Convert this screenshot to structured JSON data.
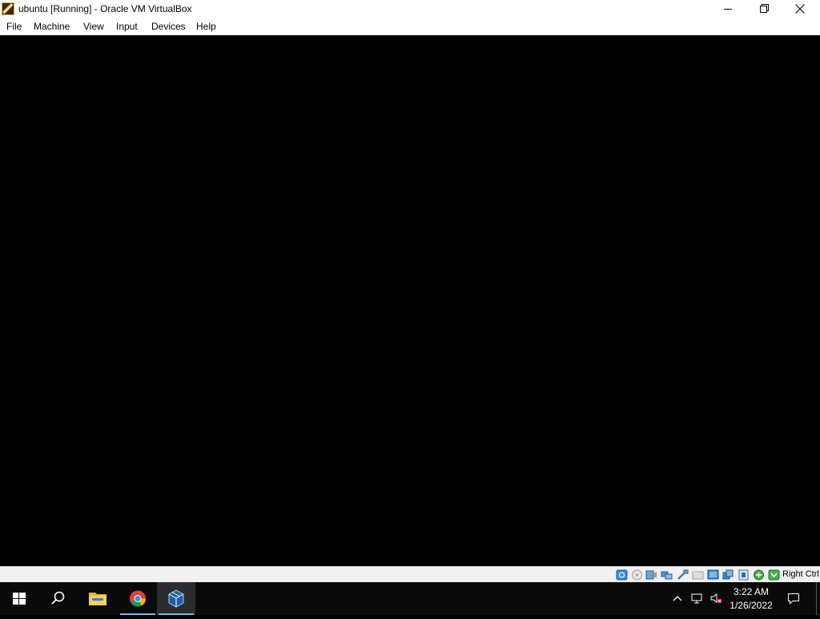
{
  "window": {
    "title": "ubuntu [Running] - Oracle VM VirtualBox",
    "app_icon": "virtualbox-icon",
    "controls": [
      "minimize-icon",
      "restore-icon",
      "close-icon"
    ]
  },
  "menu": {
    "items": [
      {
        "label": "File"
      },
      {
        "label": "Machine"
      },
      {
        "label": "View"
      },
      {
        "label": "Input"
      },
      {
        "label": "Devices"
      },
      {
        "label": "Help"
      }
    ]
  },
  "statusbar": {
    "icons": [
      "hard-disk-icon",
      "optical-drive-icon",
      "audio-icon",
      "network-icon",
      "usb-icon",
      "shared-folders-icon",
      "display-icon",
      "recording-icon",
      "virtualization-icon",
      "mouse-integration-icon",
      "keyboard-capture-icon"
    ],
    "host_key": "Right Ctrl"
  },
  "taskbar": {
    "apps": [
      "start-icon",
      "search-icon",
      "file-explorer-icon",
      "chrome-icon",
      "virtualbox-icon"
    ],
    "tray_icons": [
      "chevron-up-icon",
      "network-icon",
      "volume-muted-icon"
    ],
    "time": "3:22 AM",
    "date": "1/26/2022",
    "notification_icon": "notification-icon",
    "accent_color": "#76b9ed"
  }
}
